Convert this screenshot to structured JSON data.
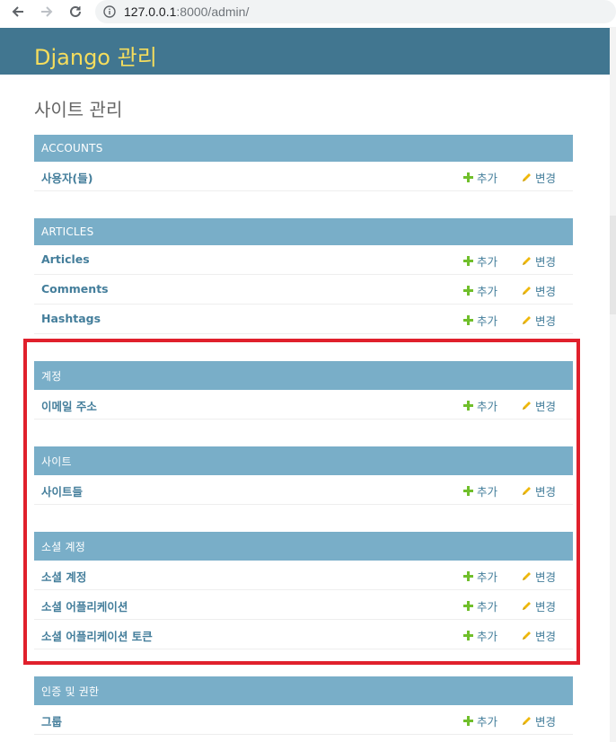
{
  "browser": {
    "url_host": "127.0.0.1",
    "url_rest": ":8000/admin/"
  },
  "header": {
    "brand": "Django 관리"
  },
  "page": {
    "title": "사이트 관리"
  },
  "modules": [
    {
      "caption": "ACCOUNTS",
      "rows": [
        {
          "name": "사용자(들)",
          "add": "추가",
          "change": "변경"
        }
      ]
    },
    {
      "caption": "ARTICLES",
      "rows": [
        {
          "name": "Articles",
          "add": "추가",
          "change": "변경"
        },
        {
          "name": "Comments",
          "add": "추가",
          "change": "변경"
        },
        {
          "name": "Hashtags",
          "add": "추가",
          "change": "변경"
        }
      ]
    },
    {
      "caption": "계정",
      "rows": [
        {
          "name": "이메일 주소",
          "add": "추가",
          "change": "변경"
        }
      ]
    },
    {
      "caption": "사이트",
      "rows": [
        {
          "name": "사이트들",
          "add": "추가",
          "change": "변경"
        }
      ]
    },
    {
      "caption": "소셜 계정",
      "rows": [
        {
          "name": "소셜 계정",
          "add": "추가",
          "change": "변경"
        },
        {
          "name": "소셜 어플리케이션",
          "add": "추가",
          "change": "변경"
        },
        {
          "name": "소셜 어플리케이션 토큰",
          "add": "추가",
          "change": "변경"
        }
      ]
    },
    {
      "caption": "인증 및 권한",
      "rows": [
        {
          "name": "그룹",
          "add": "추가",
          "change": "변경"
        }
      ]
    }
  ],
  "colors": {
    "header_bg": "#417690",
    "brand": "#f5dd5d",
    "caption_bg": "#79aec8",
    "link": "#447e9b",
    "add_icon": "#70bf2b",
    "change_icon": "#efb80b",
    "highlight": "#e0202c"
  }
}
